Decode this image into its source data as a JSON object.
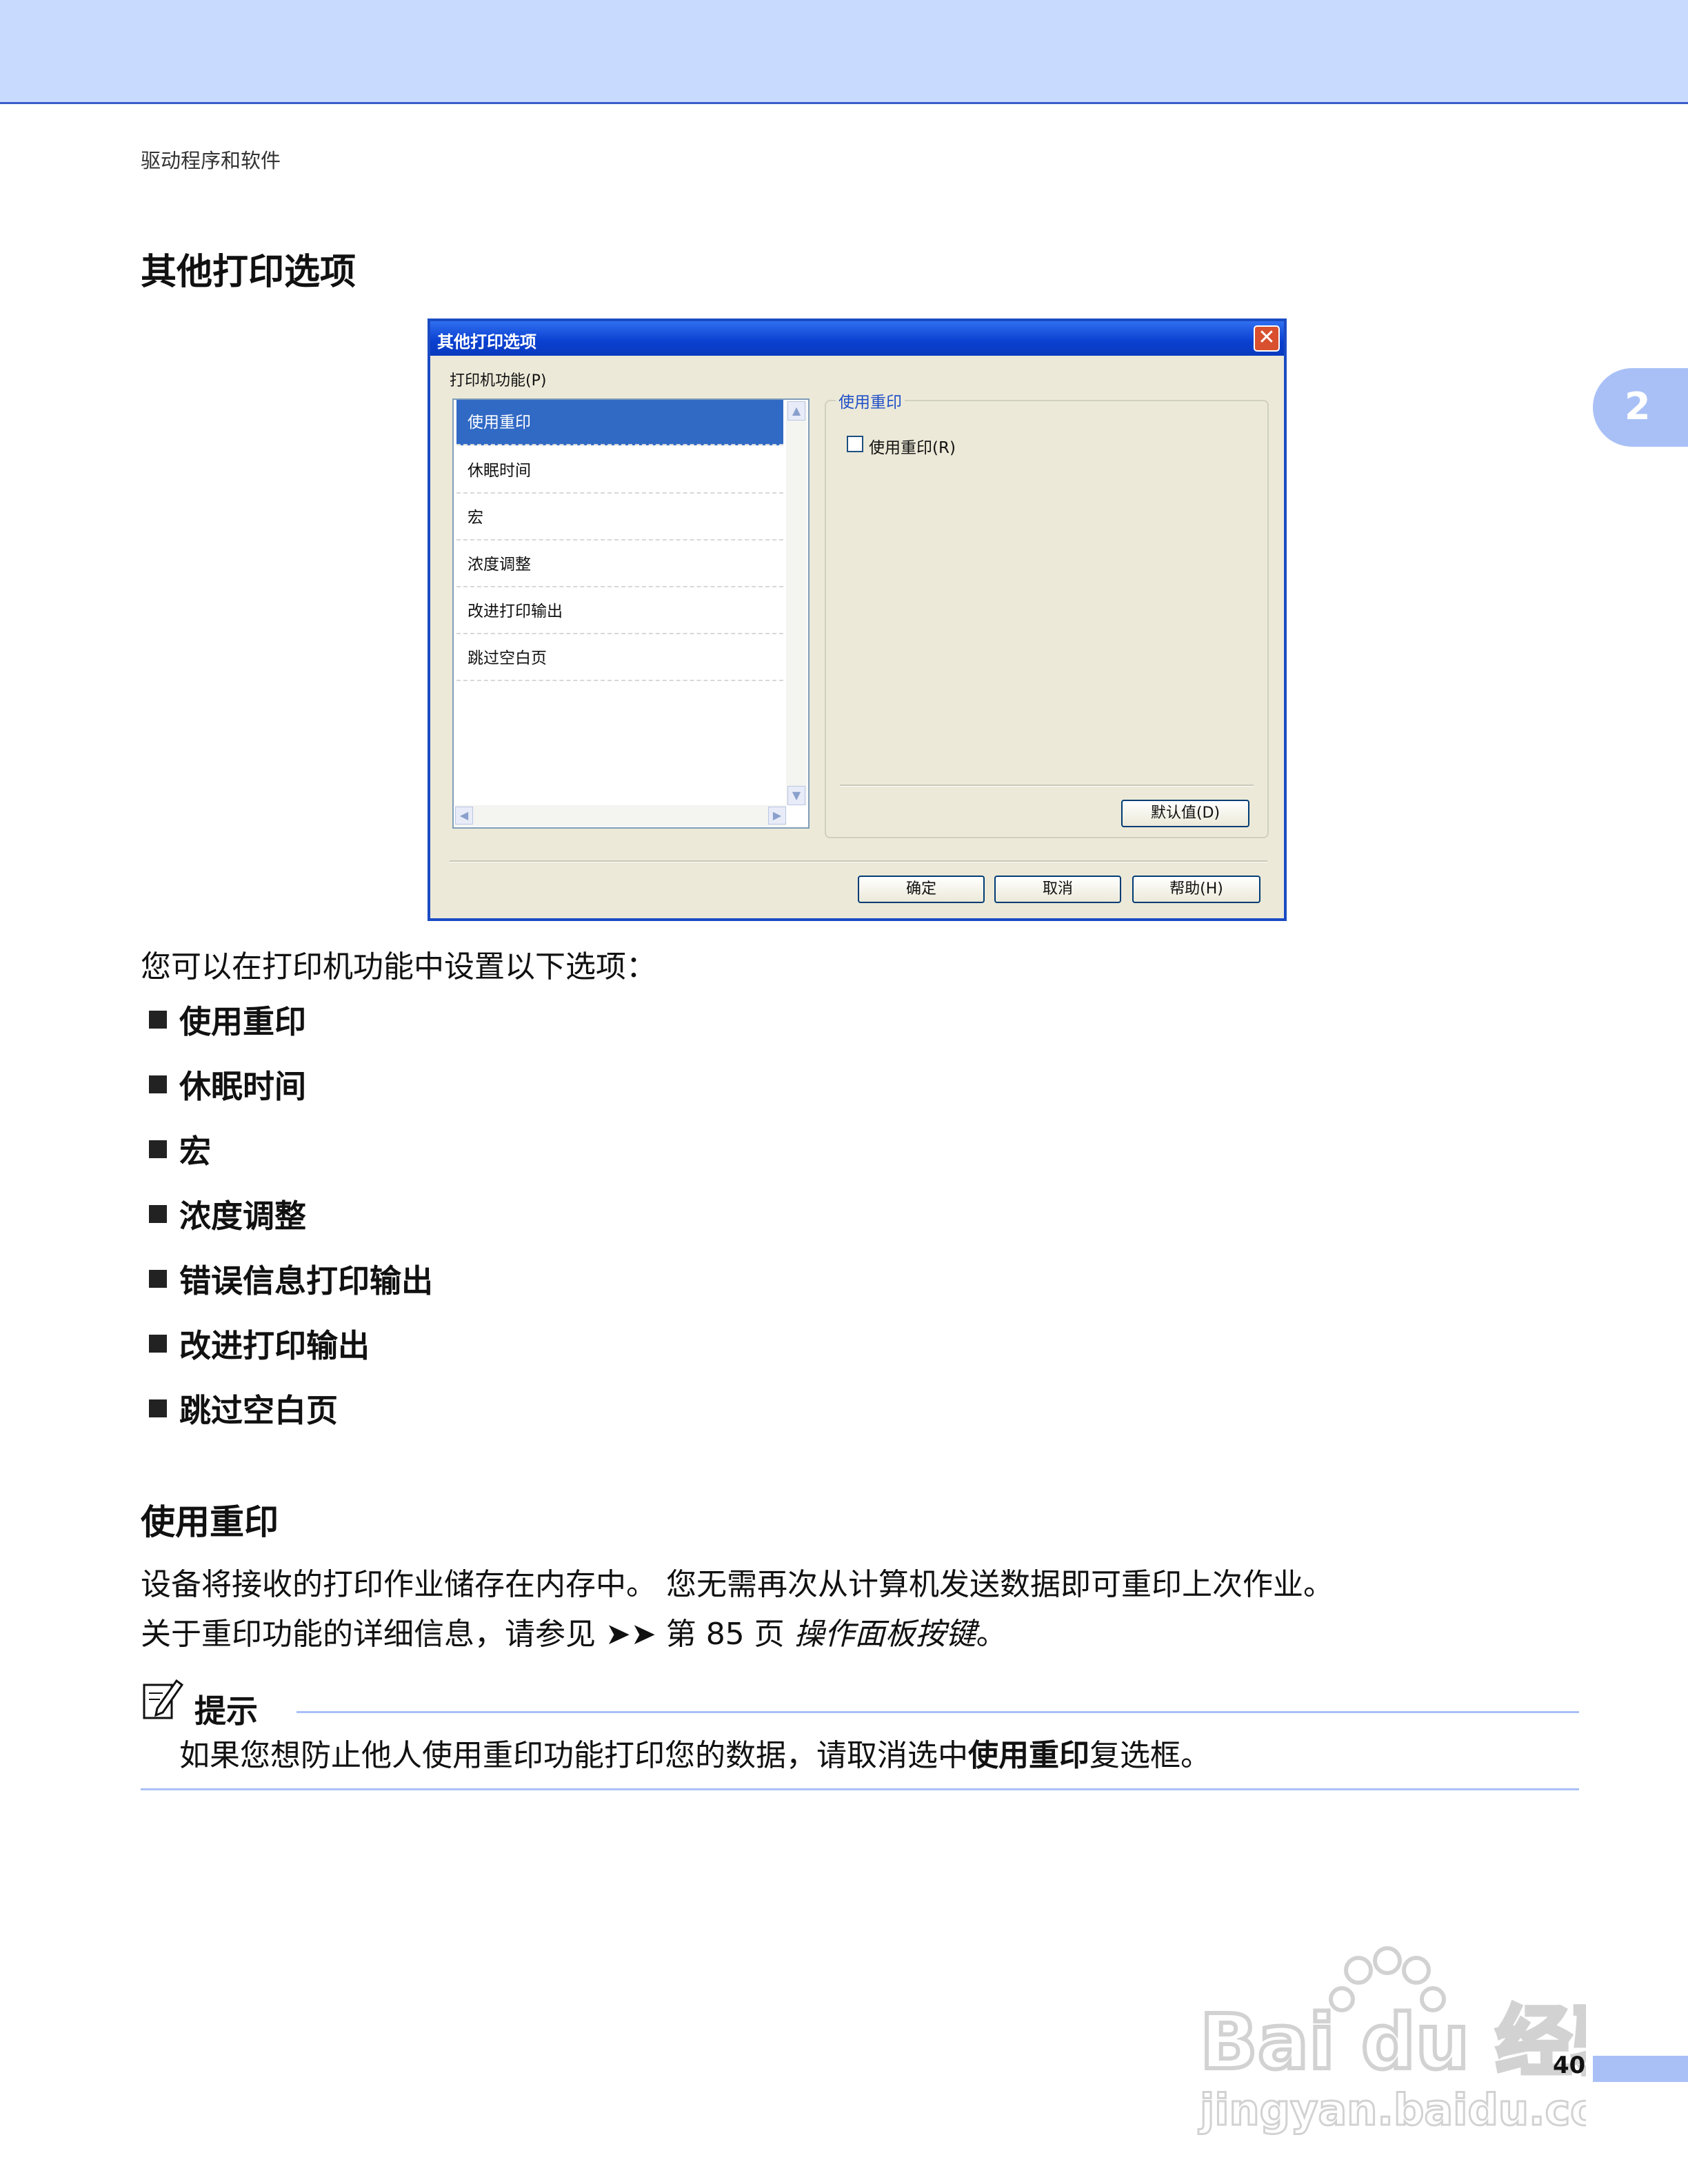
{
  "header": {
    "text": "驱动程序和软件"
  },
  "chapter_tab": {
    "number": "2"
  },
  "section_title": "其他打印选项",
  "dialog": {
    "title": "其他打印选项",
    "close_label": "✕",
    "features_label": "打印机功能(P)",
    "list_items": [
      "使用重印",
      "休眠时间",
      "宏",
      "浓度调整",
      "改进打印输出",
      "跳过空白页"
    ],
    "selected_index": 0,
    "group_label": "使用重印",
    "checkbox_label": "使用重印(R)",
    "checkbox_checked": false,
    "default_button": "默认值(D)",
    "ok_button": "确定",
    "cancel_button": "取消",
    "help_button": "帮助(H)"
  },
  "intro": "您可以在打印机功能中设置以下选项：",
  "bullets": [
    "使用重印",
    "休眠时间",
    "宏",
    "浓度调整",
    "错误信息打印输出",
    "改进打印输出",
    "跳过空白页"
  ],
  "subsection": {
    "title": "使用重印",
    "line1": "设备将接收的打印作业储存在内存中。 您无需再次从计算机发送数据即可重印上次作业。",
    "line2_prefix": "关于重印功能的详细信息，请参见 ➤➤ 第 85 页 ",
    "line2_link": "操作面板按键",
    "line2_suffix": "。"
  },
  "note": {
    "title": "提示",
    "text_prefix": "如果您想防止他人使用重印功能打印您的数据，请取消选中",
    "text_bold": "使用重印",
    "text_suffix": "复选框。"
  },
  "watermark": {
    "brand": "Bai du 经验",
    "url": "jingyan.baidu.com"
  },
  "page_number": "40",
  "colors": {
    "accent": "#a9c0f7",
    "title_bar": "#0a3fcf",
    "selection": "#316ac5"
  }
}
